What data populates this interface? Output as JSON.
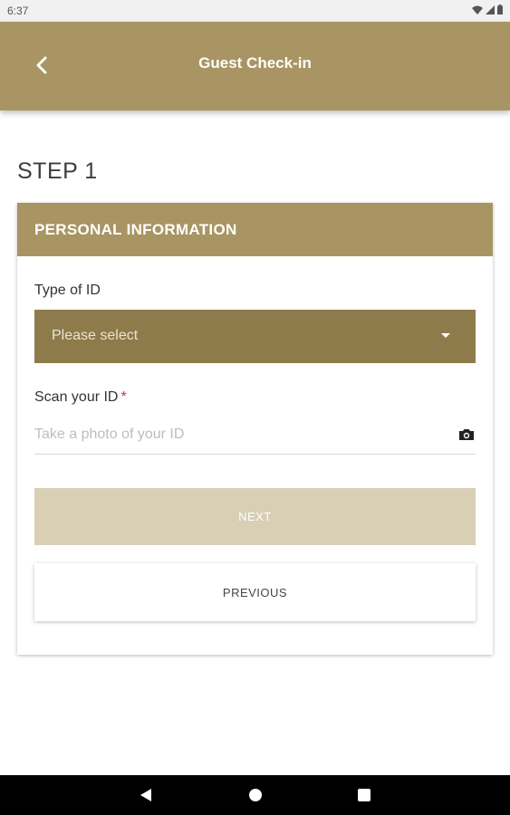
{
  "status_bar": {
    "time": "6:37"
  },
  "app_bar": {
    "title": "Guest Check-in"
  },
  "step": {
    "title": "STEP 1"
  },
  "card": {
    "header": "PERSONAL INFORMATION",
    "id_type": {
      "label": "Type of ID",
      "value": "Please select"
    },
    "scan": {
      "label": "Scan your ID",
      "required_mark": "*",
      "placeholder": "Take a photo of your ID"
    },
    "next_button": "NEXT",
    "previous_button": "PREVIOUS"
  },
  "colors": {
    "brand": "#a99563",
    "select_bg": "#8e7b4c",
    "next_disabled": "#d8cfb5",
    "required": "#d32f2f"
  },
  "icons": {
    "back": "chevron-left-icon",
    "dropdown": "caret-down-icon",
    "camera": "camera-icon",
    "nav_back": "triangle-back-icon",
    "nav_home": "circle-home-icon",
    "nav_recents": "square-recents-icon"
  }
}
